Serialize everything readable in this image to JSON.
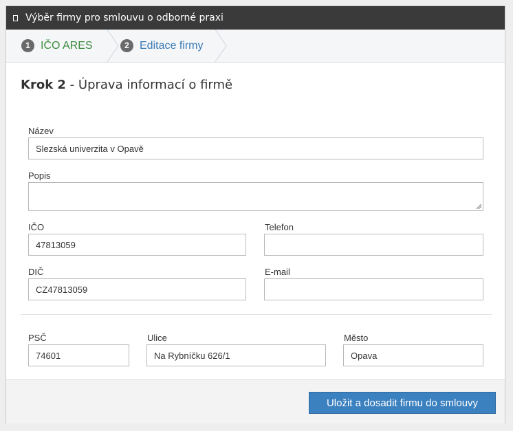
{
  "dialog": {
    "title": "Výběr firmy pro smlouvu o odborné praxi"
  },
  "steps": [
    {
      "number": "1",
      "label": "IČO ARES",
      "state": "done"
    },
    {
      "number": "2",
      "label": "Editace firmy",
      "state": "active"
    }
  ],
  "content": {
    "heading_strong": "Krok 2",
    "heading_rest": " - Úprava informací o firmě"
  },
  "form": {
    "nazev": {
      "label": "Název",
      "value": "Slezská univerzita v Opavě"
    },
    "popis": {
      "label": "Popis",
      "value": ""
    },
    "ico": {
      "label": "IČO",
      "value": "47813059"
    },
    "telefon": {
      "label": "Telefon",
      "value": ""
    },
    "dic": {
      "label": "DIČ",
      "value": "CZ47813059"
    },
    "email": {
      "label": "E-mail",
      "value": ""
    },
    "psc": {
      "label": "PSČ",
      "value": "74601"
    },
    "ulice": {
      "label": "Ulice",
      "value": "Na Rybníčku 626/1"
    },
    "mesto": {
      "label": "Město",
      "value": "Opava"
    }
  },
  "footer": {
    "save_label": "Uložit a dosadit firmu do smlouvy"
  },
  "colors": {
    "titlebar": "#3a3a3a",
    "step_done": "#3c8a3c",
    "step_active": "#3a7ab3",
    "primary_button": "#3b80bf"
  }
}
